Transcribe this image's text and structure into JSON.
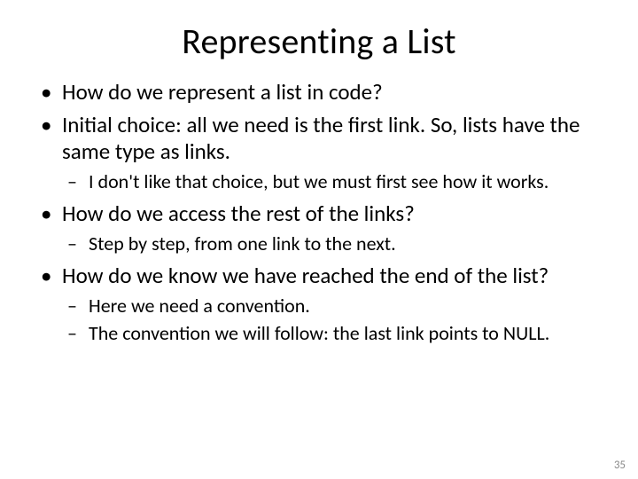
{
  "title": "Representing a List",
  "bullets": {
    "b1": "How do we represent a list in code?",
    "b2": "Initial choice: all we need is the first link. So, lists have the same type as links.",
    "b2_sub1": "I don't like that choice, but we must first see how it works.",
    "b3": "How do we access the rest of the links?",
    "b3_sub1": "Step by step, from one link to the next.",
    "b4": "How do we know we have reached the end of the list?",
    "b4_sub1": "Here we need a convention.",
    "b4_sub2": "The convention we will follow: the last link points to NULL."
  },
  "page_number": "35"
}
